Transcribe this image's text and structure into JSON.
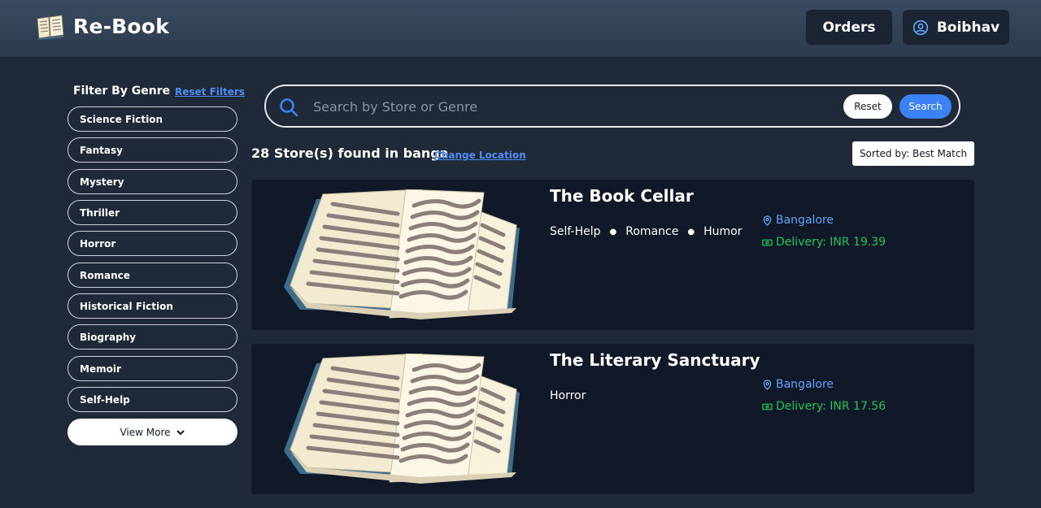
{
  "header": {
    "brand": "Re-Book",
    "orders_label": "Orders",
    "user_name": "Boibhav"
  },
  "sidebar": {
    "title": "Filter By Genre",
    "reset_label": "Reset Filters",
    "genres": [
      "Science Fiction",
      "Fantasy",
      "Mystery",
      "Thriller",
      "Horror",
      "Romance",
      "Historical Fiction",
      "Biography",
      "Memoir",
      "Self-Help"
    ],
    "view_more_label": "View More"
  },
  "search": {
    "placeholder": "Search by Store or Genre",
    "value": "",
    "reset_label": "Reset",
    "search_label": "Search"
  },
  "results": {
    "count_text": "28 Store(s) found in banga",
    "change_location_label": "Change Location",
    "sort_label": "Sorted by: Best Match"
  },
  "stores": [
    {
      "name": "The Book Cellar",
      "genres": [
        "Self-Help",
        "Romance",
        "Humor"
      ],
      "location": "Bangalore",
      "delivery": "Delivery: INR 19.39"
    },
    {
      "name": "The Literary Sanctuary",
      "genres": [
        "Horror"
      ],
      "location": "Bangalore",
      "delivery": "Delivery: INR 17.56"
    }
  ],
  "colors": {
    "background": "#1f2937",
    "card": "#111827",
    "accent_blue": "#3b82f6",
    "link_blue": "#4f8df5",
    "delivery_green": "#22c55e"
  }
}
